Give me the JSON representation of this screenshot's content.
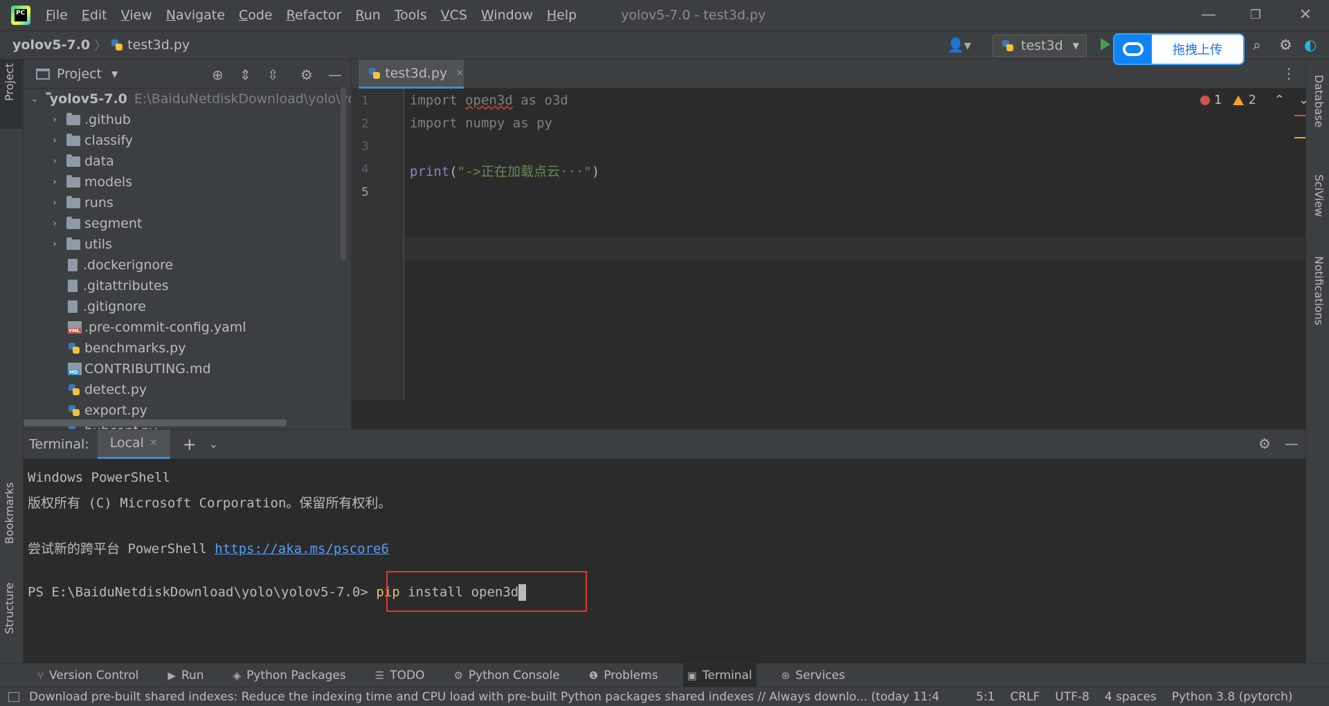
{
  "window": {
    "title": "yolov5-7.0 - test3d.py",
    "minimize_glyph": "—",
    "restore_glyph": "❐",
    "close_glyph": "✕"
  },
  "menu": [
    "File",
    "Edit",
    "View",
    "Navigate",
    "Code",
    "Refactor",
    "Run",
    "Tools",
    "VCS",
    "Window",
    "Help"
  ],
  "navbar": {
    "project": "yolov5-7.0",
    "file": "test3d.py",
    "run_config": "test3d"
  },
  "upload_overlay": {
    "label": "拖拽上传"
  },
  "left_strip": {
    "tabs": [
      "Project",
      "Bookmarks",
      "Structure"
    ]
  },
  "right_strip": {
    "tabs": [
      "Database",
      "SciView",
      "Notifications"
    ]
  },
  "project_panel": {
    "title": "Project",
    "root": {
      "name": "yolov5-7.0",
      "path": "E:\\BaiduNetdiskDownload\\yolo\\yol"
    },
    "items": [
      {
        "name": ".github",
        "kind": "folder"
      },
      {
        "name": "classify",
        "kind": "folder"
      },
      {
        "name": "data",
        "kind": "folder"
      },
      {
        "name": "models",
        "kind": "folder"
      },
      {
        "name": "runs",
        "kind": "folder"
      },
      {
        "name": "segment",
        "kind": "folder"
      },
      {
        "name": "utils",
        "kind": "folder"
      },
      {
        "name": ".dockerignore",
        "kind": "file"
      },
      {
        "name": ".gitattributes",
        "kind": "file"
      },
      {
        "name": ".gitignore",
        "kind": "file"
      },
      {
        "name": ".pre-commit-config.yaml",
        "kind": "yaml"
      },
      {
        "name": "benchmarks.py",
        "kind": "python"
      },
      {
        "name": "CONTRIBUTING.md",
        "kind": "markdown"
      },
      {
        "name": "detect.py",
        "kind": "python"
      },
      {
        "name": "export.py",
        "kind": "python"
      },
      {
        "name": "hubconf.py",
        "kind": "python"
      }
    ]
  },
  "editor": {
    "tab": "test3d.py",
    "line_numbers": [
      "1",
      "2",
      "3",
      "4",
      "5"
    ],
    "code": {
      "l1_kw": "import",
      "l1_mod": "open3d",
      "l1_as": "as",
      "l1_alias": "o3d",
      "l2_kw": "import",
      "l2_mod": "numpy",
      "l2_as": "as",
      "l2_alias": "py",
      "l4_fn": "print",
      "l4_open": "(",
      "l4_str": "\"->正在加载点云···\"",
      "l4_close": ")"
    },
    "errors": "1",
    "warnings": "2"
  },
  "terminal": {
    "label": "Terminal:",
    "tab": "Local",
    "lines": {
      "l1": "Windows PowerShell",
      "l2": "版权所有 (C) Microsoft Corporation。保留所有权利。",
      "l3_prefix": "尝试新的跨平台 PowerShell ",
      "l3_link": "https://aka.ms/pscore6",
      "prompt": "PS E:\\BaiduNetdiskDownload\\yolo\\yolov5-7.0> ",
      "cmd": "pip",
      "cmd_args": " install open3d"
    }
  },
  "tool_windows": [
    {
      "label": "Version Control",
      "icon": "version-control-icon",
      "glyph": "⑂"
    },
    {
      "label": "Run",
      "icon": "run-icon",
      "glyph": "▶"
    },
    {
      "label": "Python Packages",
      "icon": "packages-icon",
      "glyph": "◈"
    },
    {
      "label": "TODO",
      "icon": "todo-icon",
      "glyph": "☰"
    },
    {
      "label": "Python Console",
      "icon": "python-console-icon",
      "glyph": "⚙"
    },
    {
      "label": "Problems",
      "icon": "problems-icon",
      "glyph": "❶"
    },
    {
      "label": "Terminal",
      "icon": "terminal-icon",
      "glyph": "▣",
      "active": true
    },
    {
      "label": "Services",
      "icon": "services-icon",
      "glyph": "⊛"
    }
  ],
  "statusbar": {
    "message": "Download pre-built shared indexes: Reduce the indexing time and CPU load with pre-built Python packages shared indexes // Always downlo... (today 11:4",
    "position": "5:1",
    "line_sep": "CRLF",
    "encoding": "UTF-8",
    "indent": "4 spaces",
    "interpreter": "Python 3.8 (pytorch)"
  },
  "colors": {
    "accent_tab": "#4a88c7",
    "error": "#c75450",
    "warning": "#f0a732",
    "highlight_box": "#e53935"
  }
}
